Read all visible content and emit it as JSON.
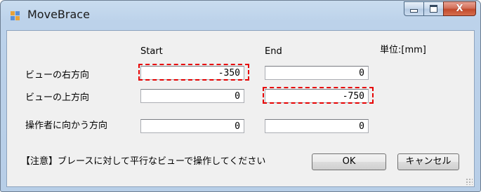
{
  "window": {
    "title": "MoveBrace",
    "icon": "app-window-icon",
    "controls": {
      "minimize": "minimize-icon",
      "maximize": "maximize-icon",
      "close": "X"
    }
  },
  "form": {
    "col_start": "Start",
    "col_end": "End",
    "unit": "単位:[mm]",
    "rows": [
      {
        "label": "ビューの右方向",
        "start": "-350",
        "end": "0"
      },
      {
        "label": "ビューの上方向",
        "start": "0",
        "end": "-750"
      },
      {
        "label": "操作者に向かう方向",
        "start": "0",
        "end": "0"
      }
    ],
    "note": "【注意】ブレースに対して平行なビューで操作してください",
    "ok_label": "OK",
    "cancel_label": "キャンセル"
  },
  "colors": {
    "highlight": "#e60000",
    "titlebar": "#c9dcef",
    "client": "#f0f0f0"
  }
}
